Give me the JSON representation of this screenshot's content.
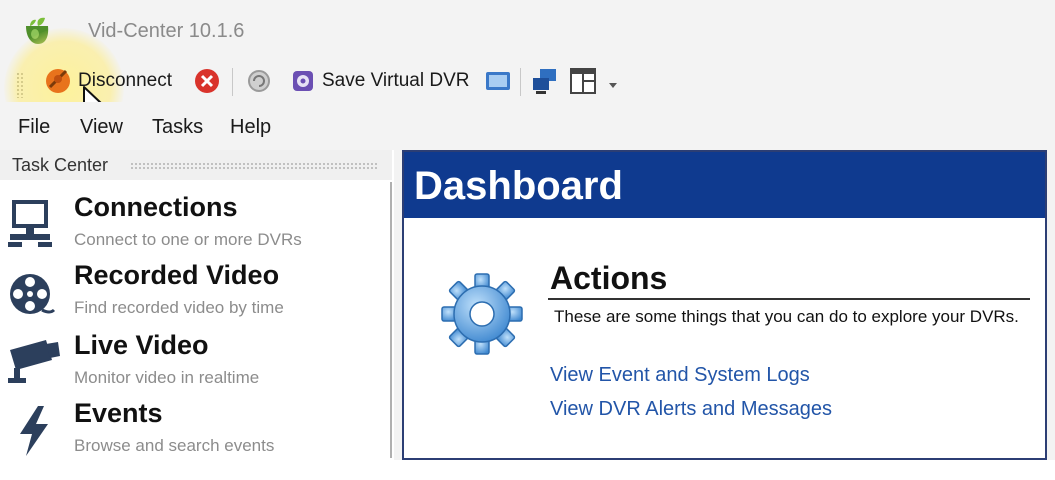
{
  "window": {
    "title": "Vid-Center 10.1.6",
    "app_icon": "app-logo-icon"
  },
  "toolbar": {
    "disconnect_label": "Disconnect",
    "save_dvr_label": "Save Virtual DVR",
    "icons": [
      "disconnect-icon",
      "stop-icon",
      "refresh-icon",
      "save-dvr-icon",
      "screen-icon",
      "network-icon",
      "layout-icon",
      "dropdown-arrow-icon"
    ]
  },
  "menu": {
    "file": "File",
    "view": "View",
    "tasks": "Tasks",
    "help": "Help"
  },
  "task_center": {
    "title": "Task Center",
    "items": [
      {
        "name": "Connections",
        "desc": "Connect to one or more DVRs",
        "icon": "computer-network-icon"
      },
      {
        "name": "Recorded Video",
        "desc": "Find recorded video by time",
        "icon": "film-reel-icon"
      },
      {
        "name": "Live Video",
        "desc": "Monitor video in realtime",
        "icon": "camera-icon"
      },
      {
        "name": "Events",
        "desc": "Browse and search events",
        "icon": "lightning-icon"
      }
    ]
  },
  "dashboard": {
    "title": "Dashboard",
    "actions_title": "Actions",
    "actions_desc": "These are some things that you can do to explore your DVRs.",
    "links": [
      "View Event and System Logs",
      "View DVR Alerts and Messages"
    ]
  },
  "colors": {
    "header_blue": "#0f3a8f",
    "link_blue": "#2255a8",
    "highlight_yellow": "#fff28c"
  }
}
